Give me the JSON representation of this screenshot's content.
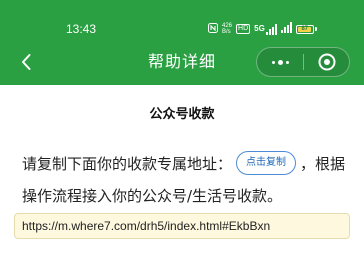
{
  "status_bar": {
    "time": "13:43",
    "indicators": [
      "nfc-icon",
      "4G-data",
      "volte-icon",
      "5G-signal",
      "signal"
    ],
    "data_speed": "426",
    "data_speed_unit": "B/s",
    "hd_badge": "HD",
    "network_type_1": "5G",
    "battery_level": "87"
  },
  "nav": {
    "back_icon": "chevron-left-icon",
    "title": "帮助详细",
    "more_icon": "more-dots-icon",
    "close_icon": "target-close-icon"
  },
  "content": {
    "section_title": "公众号收款",
    "instruction_before": "请复制下面你的收款专属地址：",
    "copy_button_label": "点击复制",
    "instruction_after": "，根据操作流程接入你的公众号/生活号收款。",
    "address_url": "https://m.where7.com/drh5/index.html#EkbBxn"
  },
  "colors": {
    "header_bg": "#2aa043",
    "header_text": "#ffffff",
    "copy_button_border": "#4d8bd6",
    "copy_button_text": "#1e68b8",
    "url_box_bg": "#fdf8de",
    "url_box_border": "#e7dcae"
  }
}
